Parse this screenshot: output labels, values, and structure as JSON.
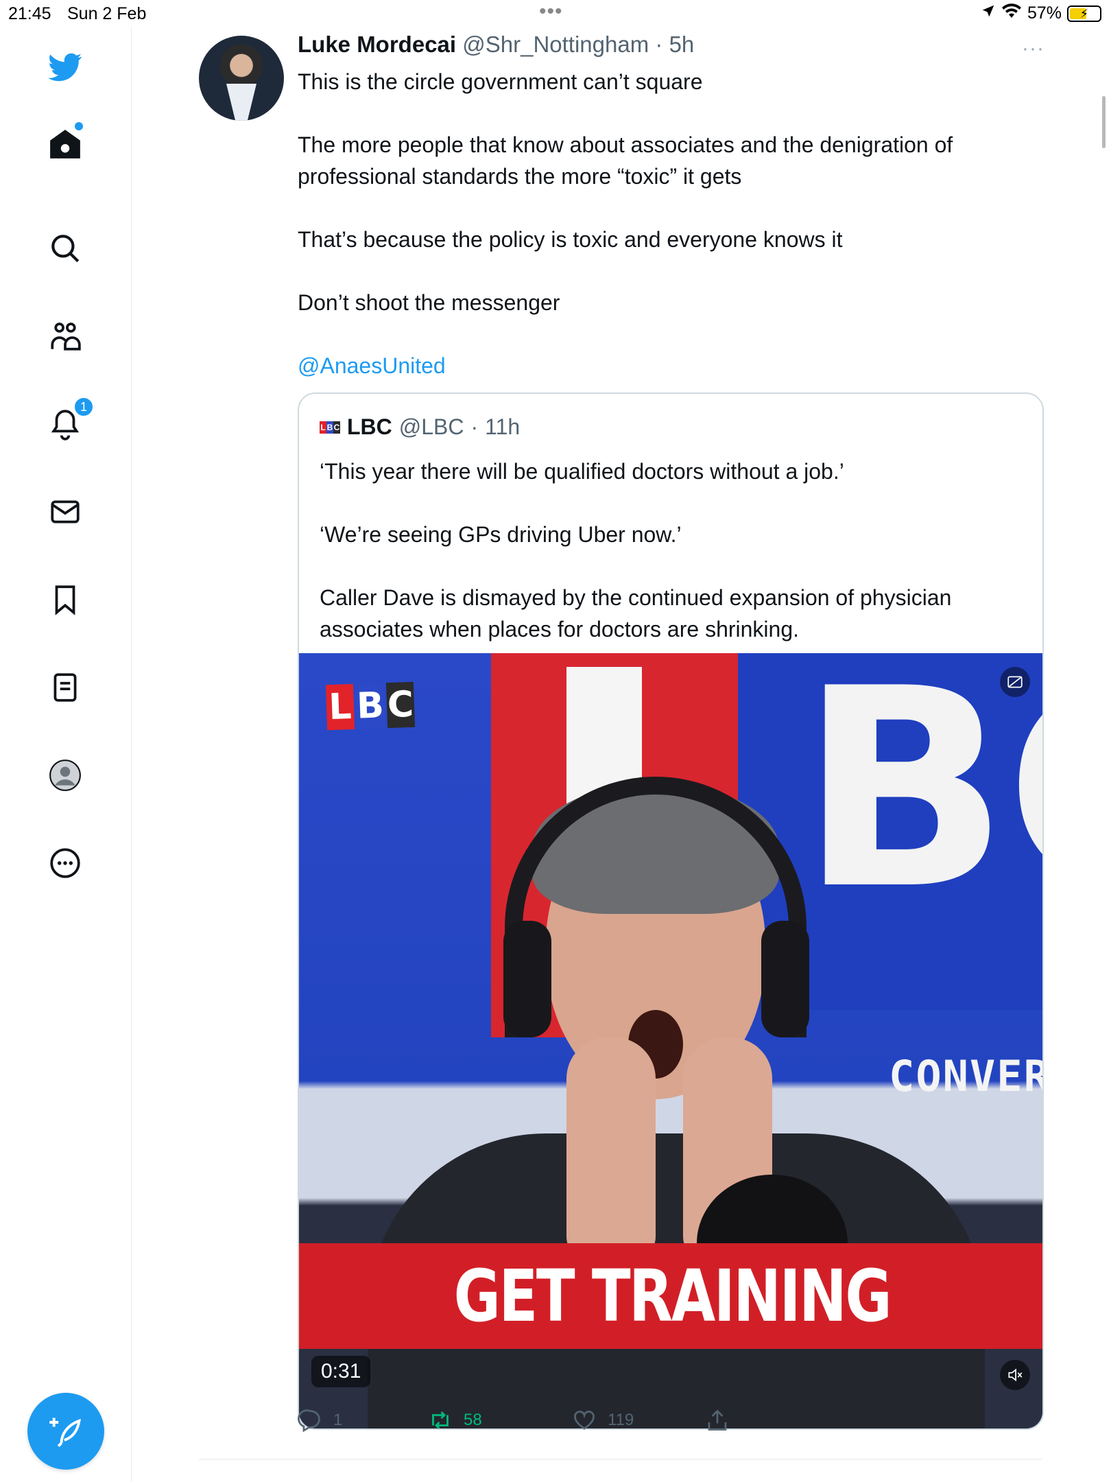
{
  "status_bar": {
    "time": "21:45",
    "date": "Sun 2 Feb",
    "battery": "57%"
  },
  "sidebar": {
    "items": [
      {
        "name": "twitter-logo-icon"
      },
      {
        "name": "home-icon"
      },
      {
        "name": "search-icon"
      },
      {
        "name": "communities-icon"
      },
      {
        "name": "notifications-icon",
        "badge": "1"
      },
      {
        "name": "messages-icon"
      },
      {
        "name": "bookmarks-icon"
      },
      {
        "name": "lists-icon"
      },
      {
        "name": "profile-icon"
      },
      {
        "name": "more-icon"
      }
    ],
    "compose_icon": "feather-plus-icon"
  },
  "tweet": {
    "name": "Luke Mordecai",
    "handle": "@Shr_Nottingham",
    "sep": "·",
    "age": "5h",
    "more": "···",
    "lines": [
      "This is the circle government can’t square",
      "",
      "The more people that know about associates and the denigration of professional standards the more “toxic” it gets",
      "",
      "That’s because the policy is toxic and everyone knows it",
      "",
      "Don’t shoot the messenger",
      ""
    ],
    "mention": "@AnaesUnited",
    "quote": {
      "name": "LBC",
      "handle": "@LBC",
      "sep": "·",
      "age": "11h",
      "lines": [
        "‘This year there will be qualified doctors without a job.’",
        "",
        "‘We’re seeing GPs driving Uber now.’",
        "",
        "Caller Dave is dismayed by the continued expansion of physician associates when places for doctors are shrinking."
      ],
      "video": {
        "logo_letters": [
          "L",
          "B",
          "C"
        ],
        "logo_colors": [
          "#e2232a",
          "#2c49c8",
          "#2b2b2b"
        ],
        "backdrop_letters": [
          "B",
          "C"
        ],
        "backdrop_text": "CONVERS",
        "caption": "GET TRAINING",
        "duration": "0:31"
      }
    },
    "actions": {
      "reply_count": "1",
      "retweet_count": "58",
      "like_count": "119"
    }
  },
  "colors": {
    "accent": "#1d9bf0",
    "retweet_green": "#00ba7c",
    "secondary_text": "#536471",
    "lbc_red": "#d21f27"
  }
}
